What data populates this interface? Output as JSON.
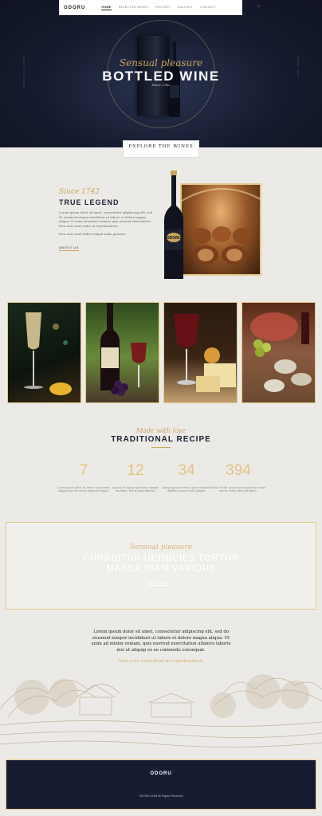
{
  "nav": {
    "logo": "ODORU",
    "items": [
      {
        "label": "HOME"
      },
      {
        "label": "SELECTED WINES"
      },
      {
        "label": "HISTORY"
      },
      {
        "label": "GALLERY"
      },
      {
        "label": "CONTACT"
      }
    ],
    "icons": [
      "search-icon",
      "cart-icon"
    ]
  },
  "hero": {
    "tagline": "Sensual pleasure",
    "title": "BOTTLED WINE",
    "subtitle": "Since 1742",
    "side_left": "ENJOY THE TASTE",
    "side_right": "SINCE 1742",
    "cta": "EXPLORE THE WINES"
  },
  "legend": {
    "since": "Since 1742",
    "title": "TRUE LEGEND",
    "text": "Lorem ipsum dolor sit amet, consectetur adipisicing elit, sed do eiusmod tempor incididunt ut labore et dolore magna aliqua. Ut enim ad minim veniam, quis nostrud exercitation. Duis aute irure dolor in reprehenderit.",
    "link_text": "Duis aute irure dolor reliquit nulla pariatur.",
    "button": "ABOUT US"
  },
  "gallery": [
    "champagne-photo",
    "red-wine-bottle-photo",
    "wine-cheese-photo",
    "seafood-platter-photo"
  ],
  "recipe": {
    "tagline": "Made with love",
    "title": "TRADITIONAL RECIPE",
    "stats": [
      {
        "value": "7",
        "text": "Lorem ipsum dolor sit amet, consectetur adipisicing elit sed do eiusmod tempor."
      },
      {
        "value": "12",
        "text": "Aenean eu ligula eget dolor semper tincidunt. Sed in diam efficitur."
      },
      {
        "value": "34",
        "text": "Integer posuere erat a ante venenatis dapibus posuere velit aliquet."
      },
      {
        "value": "394",
        "text": "Donec id elit non mi porta gravida at eget metus. Nulla vitae elit libero."
      }
    ]
  },
  "banner": {
    "tagline": "Sensual pleasure",
    "title_line1": "CURABITUR ULTRICIES TORTOR",
    "title_line2": "MASSA DIAM VARIOUS",
    "button": "READ MORE"
  },
  "quote": {
    "text": "Lorem ipsum dolor sit amet, consectetur adipiscing elit, sed do eiusmod tempor incididunt ut labore et dolore magna aliqua. Ut enim ad minim veniam, quis nostrud exercitation ullamco laboris nisi ut aliquip ex ea commodo consequat.",
    "link": "Duis aute irure dolor in reprehenderit."
  },
  "footer": {
    "logo": "ODORU",
    "copyright": "ODORU.COM All Rights Reserved"
  },
  "colors": {
    "gold": "#c9a560",
    "navy": "#181c33"
  }
}
